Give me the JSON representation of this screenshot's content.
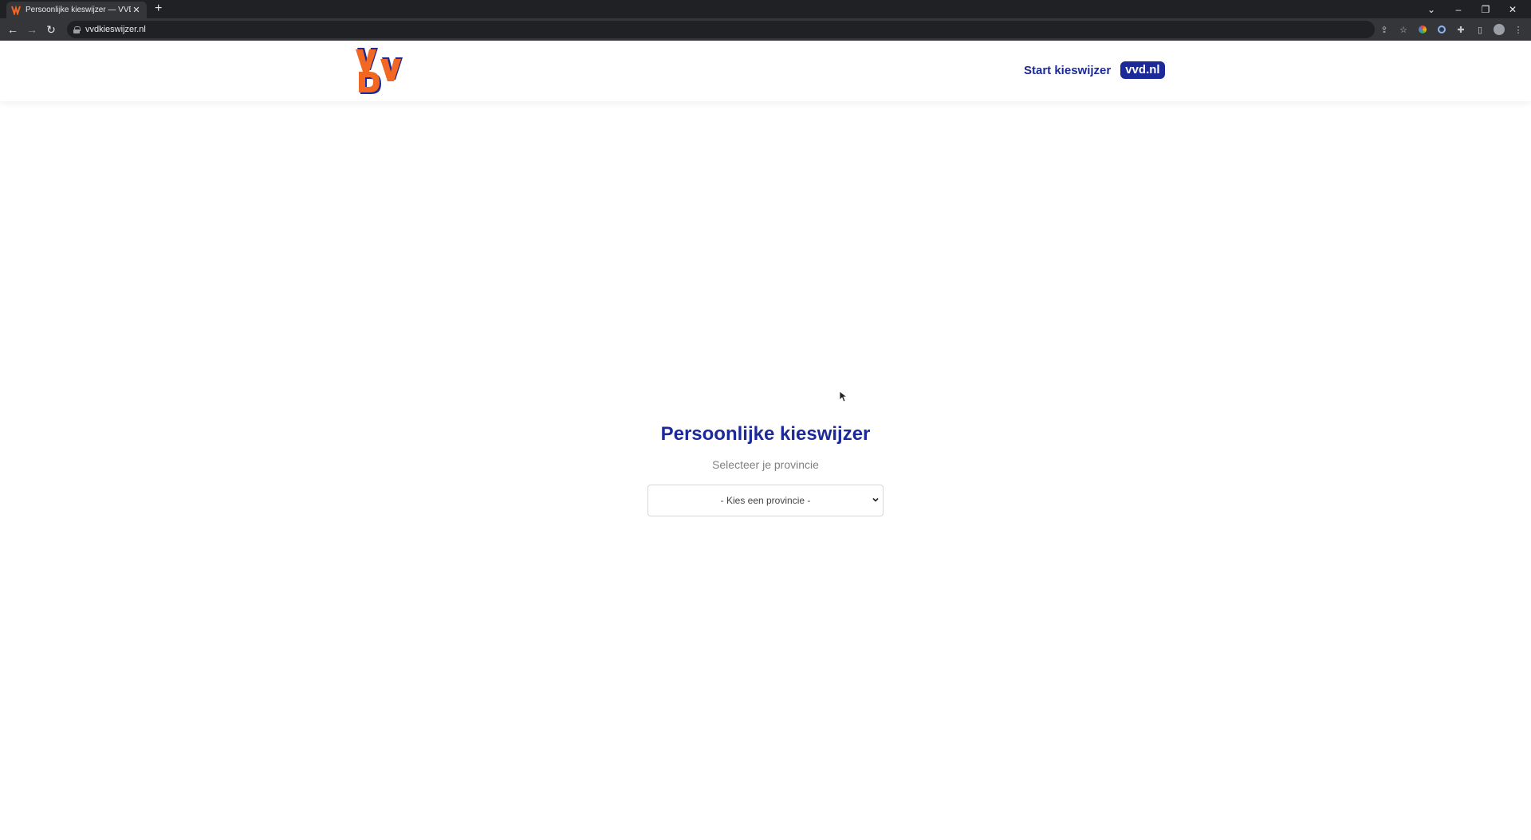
{
  "browser": {
    "tab_title": "Persoonlijke kieswijzer — VVD K",
    "url": "vvdkieswijzer.nl"
  },
  "site": {
    "logo_alt": "VVD",
    "nav": {
      "start_label": "Start kieswijzer",
      "badge_label": "vvd.nl"
    },
    "main": {
      "title": "Persoonlijke kieswijzer",
      "subtitle": "Selecteer je provincie",
      "select_value": "- Kies een provincie -"
    }
  },
  "colors": {
    "brand_blue": "#1c2999",
    "brand_orange": "#f26722"
  }
}
